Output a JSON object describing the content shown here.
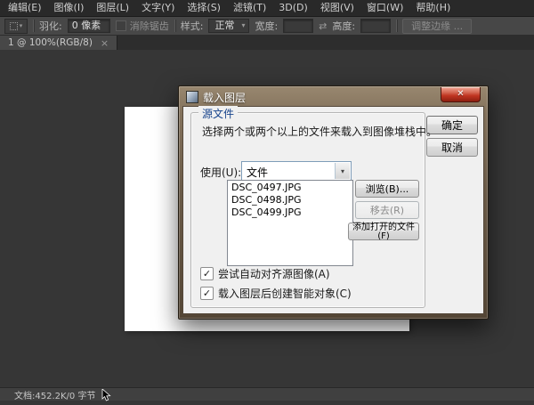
{
  "menu_bar": {
    "items": [
      {
        "label": "编辑(E)"
      },
      {
        "label": "图像(I)"
      },
      {
        "label": "图层(L)"
      },
      {
        "label": "文字(Y)"
      },
      {
        "label": "选择(S)"
      },
      {
        "label": "滤镜(T)"
      },
      {
        "label": "3D(D)"
      },
      {
        "label": "视图(V)"
      },
      {
        "label": "窗口(W)"
      },
      {
        "label": "帮助(H)"
      }
    ]
  },
  "options_bar": {
    "feather_label": "羽化:",
    "feather_value": "0 像素",
    "antialias_label": "消除锯齿",
    "style_label": "样式:",
    "style_value": "正常",
    "width_label": "宽度:",
    "width_value": "",
    "height_label": "高度:",
    "height_value": "",
    "refine_edge_label": "调整边缘 ..."
  },
  "document_tab": {
    "label": "1 @ 100%(RGB/8)"
  },
  "dialog": {
    "title": "载入图层",
    "ok_label": "确定",
    "cancel_label": "取消",
    "source_group": {
      "title": "源文件",
      "description": "选择两个或两个以上的文件来载入到图像堆栈中。",
      "use_label": "使用(U):",
      "use_value": "文件",
      "files": [
        "DSC_0497.JPG",
        "DSC_0498.JPG",
        "DSC_0499.JPG"
      ],
      "browse_label": "浏览(B)...",
      "remove_label": "移去(R)",
      "add_open_label": "添加打开的文件(F)",
      "auto_align_label": "尝试自动对齐源图像(A)",
      "auto_align_checked": true,
      "smart_object_label": "载入图层后创建智能对象(C)",
      "smart_object_checked": true
    }
  },
  "status_bar": {
    "text": "文档:452.2K/0 字节"
  },
  "icons": {
    "close": "✕",
    "tab_close": "×",
    "dropdown_arrow": "▾",
    "swap": "⇄",
    "check": "✓"
  },
  "colors": {
    "menu_bar_bg": "#292929",
    "options_bar_bg": "#474747",
    "canvas_bg": "#363636",
    "dialog_frame_top": "#98876f",
    "dialog_frame_bottom": "#544635",
    "dialog_client_bg": "#f0f0f0",
    "close_button_red": "#bf3420",
    "combo_border": "#7f9db9"
  }
}
